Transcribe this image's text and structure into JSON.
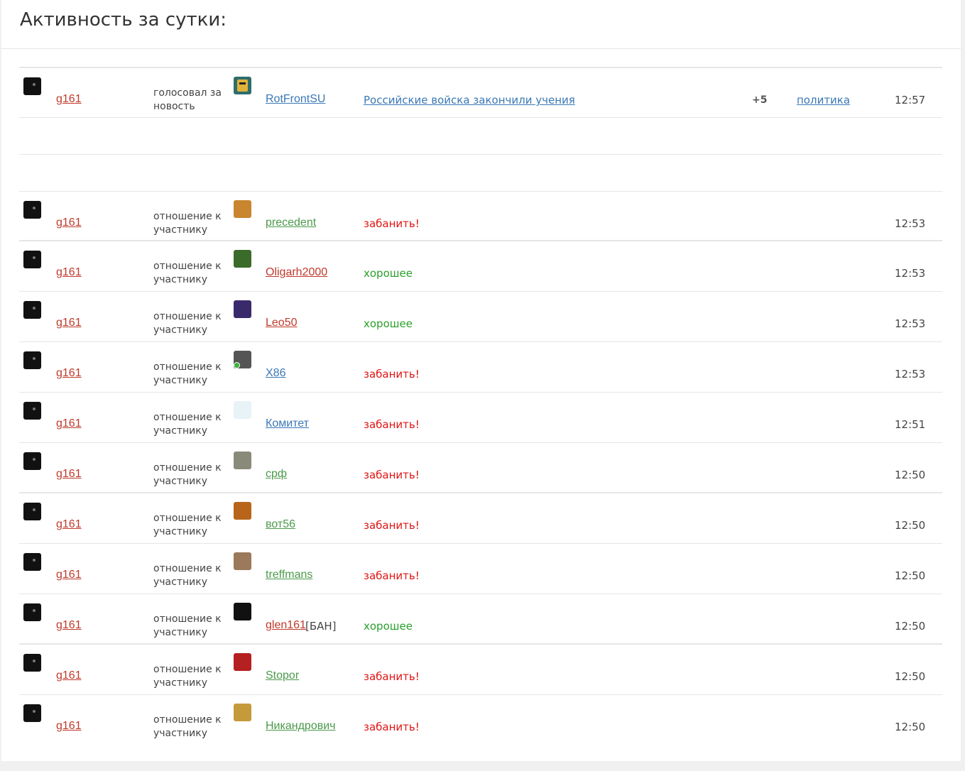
{
  "header": {
    "title": "Активность за сутки:"
  },
  "news_row": {
    "actor": "g161",
    "action": "голосовал за новость",
    "target": "RotFrontSU",
    "news_title": "Российские войска закончили учения",
    "score": "+5",
    "category": "политика",
    "time": "12:57"
  },
  "rows": [
    {
      "actor": "g161",
      "action": "отношение к участнику",
      "target": "precedent",
      "target_color": "green",
      "value": "забанить!",
      "value_type": "bad",
      "time": "12:53",
      "avatar_color": "#c9852f"
    },
    {
      "actor": "g161",
      "action": "отношение к участнику",
      "target": "Oligarh2000",
      "target_color": "red",
      "value": "хорошее",
      "value_type": "good",
      "time": "12:53",
      "avatar_color": "#3a6b2a"
    },
    {
      "actor": "g161",
      "action": "отношение к участнику",
      "target": "Leo50",
      "target_color": "red",
      "value": "хорошее",
      "value_type": "good",
      "time": "12:53",
      "avatar_color": "#3b2a6b"
    },
    {
      "actor": "g161",
      "action": "отношение к участнику",
      "target": "X86",
      "target_color": "blue",
      "value": "забанить!",
      "value_type": "bad",
      "time": "12:53",
      "avatar_color": "#555555",
      "online": true
    },
    {
      "actor": "g161",
      "action": "отношение к участнику",
      "target": "Комитет",
      "target_color": "blue",
      "value": "забанить!",
      "value_type": "bad",
      "time": "12:51",
      "avatar_color": "#e8f3f8"
    },
    {
      "actor": "g161",
      "action": "отношение к участнику",
      "target": "срф",
      "target_color": "green",
      "value": "забанить!",
      "value_type": "bad",
      "time": "12:50",
      "avatar_color": "#8a8a7a"
    },
    {
      "actor": "g161",
      "action": "отношение к участнику",
      "target": "вот56",
      "target_color": "green",
      "value": "забанить!",
      "value_type": "bad",
      "time": "12:50",
      "avatar_color": "#b8651b"
    },
    {
      "actor": "g161",
      "action": "отношение к участнику",
      "target": "treffmans",
      "target_color": "green",
      "value": "забанить!",
      "value_type": "bad",
      "time": "12:50",
      "avatar_color": "#9a7a5a"
    },
    {
      "actor": "g161",
      "action": "отношение к участнику",
      "target": "glen161",
      "ban_tag": "[БАН]",
      "target_color": "red",
      "value": "хорошее",
      "value_type": "good",
      "time": "12:50",
      "avatar_color": "#111111"
    },
    {
      "actor": "g161",
      "action": "отношение к участнику",
      "target": "Stopor",
      "target_color": "green",
      "value": "забанить!",
      "value_type": "bad",
      "time": "12:50",
      "avatar_color": "#b52020"
    },
    {
      "actor": "g161",
      "action": "отношение к участнику",
      "target": "Никандрович",
      "target_color": "green",
      "value": "забанить!",
      "value_type": "bad",
      "time": "12:50",
      "avatar_color": "#c49a3a"
    }
  ]
}
